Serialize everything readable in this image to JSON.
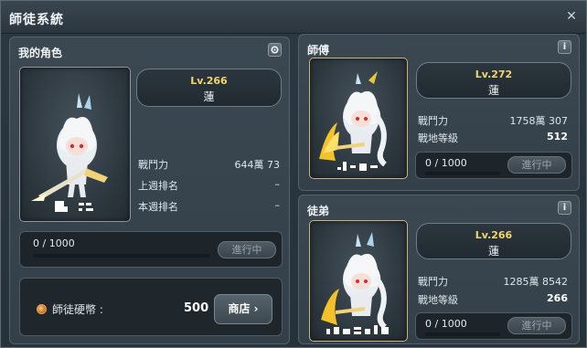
{
  "window": {
    "title": "師徒系統",
    "close_label": "✕"
  },
  "my_character": {
    "title": "我的角色",
    "level": "Lv.266",
    "guild": "蓮",
    "stats": [
      {
        "label": "戰鬥力",
        "value": "644萬 73"
      },
      {
        "label": "上週排名",
        "value": "–"
      },
      {
        "label": "本週排名",
        "value": "–"
      }
    ],
    "progress": {
      "text": "0 / 1000",
      "fraction": 0
    },
    "status_button": "進行中",
    "coin": {
      "label": "師徒硬幣 :",
      "amount": "500"
    },
    "shop_button": "商店 ›"
  },
  "master": {
    "title": "師傅",
    "info_label": "i",
    "level": "Lv.272",
    "guild": "蓮",
    "stats": [
      {
        "label": "戰鬥力",
        "value": "1758萬 307"
      },
      {
        "label": "戰地等級",
        "value": "512"
      }
    ],
    "progress": {
      "text": "0 / 1000",
      "fraction": 0
    },
    "status_button": "進行中"
  },
  "apprentice": {
    "title": "徒弟",
    "info_label": "i",
    "level": "Lv.266",
    "guild": "蓮",
    "stats": [
      {
        "label": "戰鬥力",
        "value": "1285萬 8542"
      },
      {
        "label": "戰地等級",
        "value": "266"
      }
    ],
    "progress": {
      "text": "0 / 1000",
      "fraction": 0
    },
    "status_button": "進行中"
  },
  "icons": {
    "settings": "gear-icon",
    "info": "info-icon",
    "coin": "coin-icon",
    "close": "close-icon"
  },
  "colors": {
    "level_text": "#f3d56a",
    "progress_fill": "#58c2e8",
    "coin": "#f0a050"
  }
}
